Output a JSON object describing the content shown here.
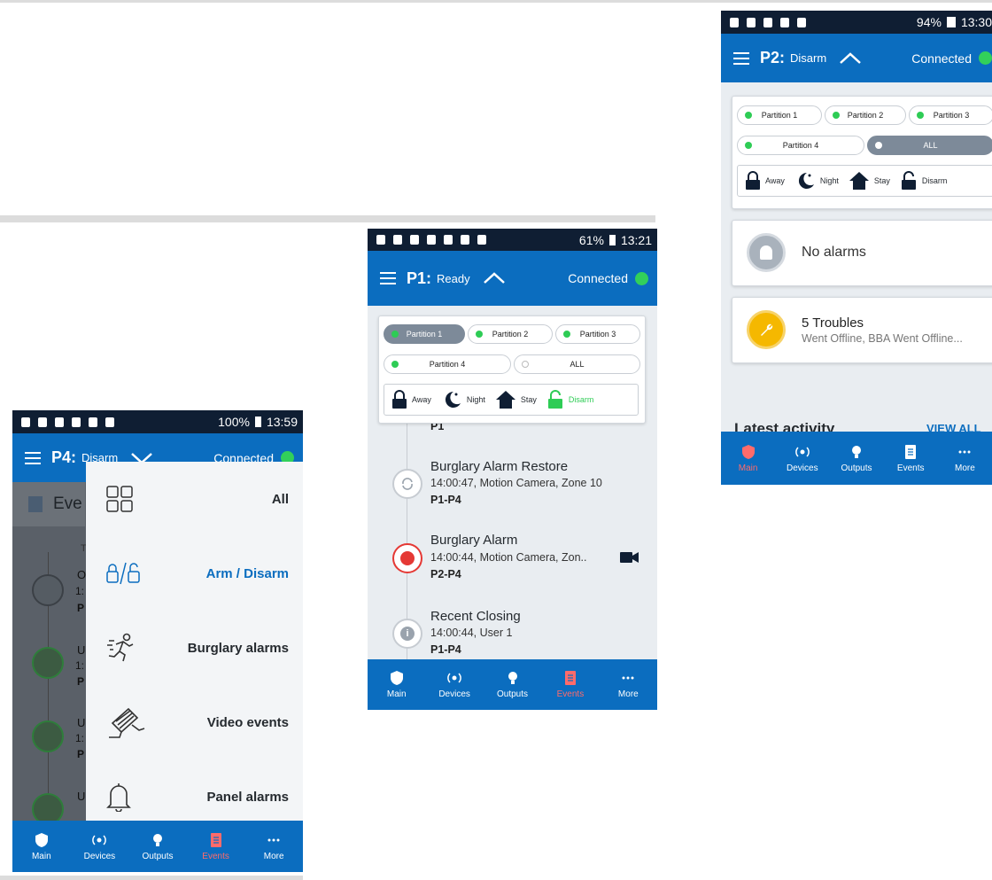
{
  "phone_p4": {
    "status": {
      "battery": "100%",
      "time": "13:59"
    },
    "appbar": {
      "partition": "P4:",
      "state": "Disarm",
      "connection": "Connected"
    },
    "behind": {
      "title_fragment": "Eve",
      "rows": [
        "O",
        "1:",
        "P",
        "U",
        "1:",
        "P",
        "U",
        "1:",
        "P",
        "U"
      ],
      "col_header": "T"
    },
    "menu": [
      {
        "label": "All",
        "icon": "grid-icon",
        "active": false
      },
      {
        "label": "Arm / Disarm",
        "icon": "lock-unlock-icon",
        "active": true
      },
      {
        "label": "Burglary alarms",
        "icon": "running-person-icon",
        "active": false
      },
      {
        "label": "Video events",
        "icon": "camera-icon",
        "active": false
      },
      {
        "label": "Panel alarms",
        "icon": "bell-icon",
        "active": false
      }
    ],
    "nav": [
      {
        "label": "Main",
        "icon": "shield-icon",
        "active": false
      },
      {
        "label": "Devices",
        "icon": "devices-icon",
        "active": false
      },
      {
        "label": "Outputs",
        "icon": "bulb-icon",
        "active": false
      },
      {
        "label": "Events",
        "icon": "events-icon",
        "active": true
      },
      {
        "label": "More",
        "icon": "more-icon",
        "active": false
      }
    ]
  },
  "phone_p1": {
    "status": {
      "battery": "61%",
      "time": "13:21"
    },
    "appbar": {
      "partition": "P1:",
      "state": "Ready",
      "connection": "Connected"
    },
    "partitions": [
      {
        "label": "Partition 1",
        "dot": "green",
        "selected": true
      },
      {
        "label": "Partition 2",
        "dot": "green",
        "selected": false
      },
      {
        "label": "Partition 3",
        "dot": "green",
        "selected": false
      },
      {
        "label": "Partition 4",
        "dot": "green",
        "selected": false
      },
      {
        "label": "ALL",
        "dot": "empty",
        "selected": false
      }
    ],
    "modes": {
      "away": "Away",
      "night": "Night",
      "stay": "Stay",
      "disarm": "Disarm"
    },
    "partial_event_partition": "P1",
    "events": [
      {
        "title": "Burglary Alarm Restore",
        "detail": "14:00:47, Motion Camera, Zone 10",
        "partitions": "P1-P4",
        "icon": "restore-icon"
      },
      {
        "title": "Burglary Alarm",
        "detail": "14:00:44, Motion Camera, Zon..",
        "partitions": "P2-P4",
        "icon": "siren-icon"
      },
      {
        "title": "Recent Closing",
        "detail": "14:00:44, User 1",
        "partitions": "P1-P4",
        "icon": "info-icon"
      }
    ],
    "nav": [
      {
        "label": "Main",
        "active": false
      },
      {
        "label": "Devices",
        "active": false
      },
      {
        "label": "Outputs",
        "active": false
      },
      {
        "label": "Events",
        "active": true
      },
      {
        "label": "More",
        "active": false
      }
    ]
  },
  "phone_p2": {
    "status": {
      "battery": "94%",
      "time": "13:30"
    },
    "appbar": {
      "partition": "P2:",
      "state": "Disarm",
      "connection": "Connected"
    },
    "partitions": [
      {
        "label": "Partition 1",
        "dot": "green",
        "selected": false
      },
      {
        "label": "Partition 2",
        "dot": "green",
        "selected": false
      },
      {
        "label": "Partition 3",
        "dot": "green",
        "selected": false
      },
      {
        "label": "Partition 4",
        "dot": "green",
        "selected": false
      },
      {
        "label": "ALL",
        "dot": "white",
        "selected": true
      }
    ],
    "modes": {
      "away": "Away",
      "night": "Night",
      "stay": "Stay",
      "disarm": "Disarm"
    },
    "alarms_text": "No alarms",
    "troubles_title": "5 Troubles",
    "troubles_detail": "Went Offline, BBA Went Offline...",
    "activity_title": "Latest activity",
    "view_all": "VIEW ALL",
    "nav": [
      {
        "label": "Main",
        "active": true
      },
      {
        "label": "Devices",
        "active": false
      },
      {
        "label": "Outputs",
        "active": false
      },
      {
        "label": "Events",
        "active": false
      },
      {
        "label": "More",
        "active": false
      }
    ]
  },
  "colors": {
    "appbar": "#0b6dbf",
    "status_bar": "#0f1e33",
    "connected_dot": "#32d05a",
    "active_nav": "#ff6b6b",
    "alarm_red": "#e53935",
    "trouble_yellow": "#f5b800"
  }
}
